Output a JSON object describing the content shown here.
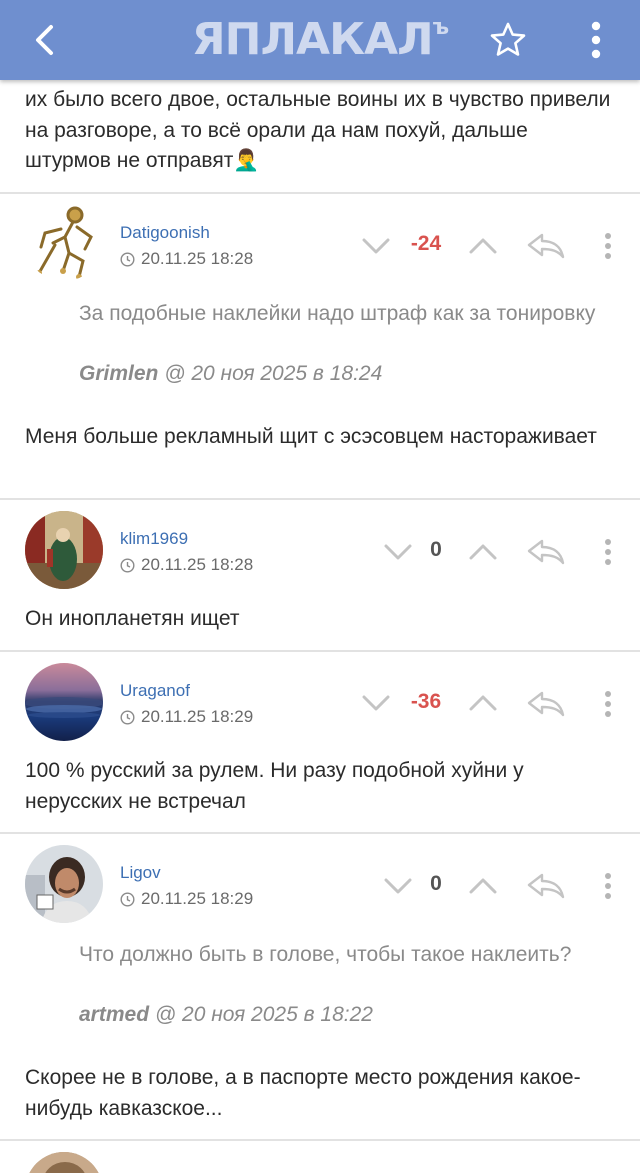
{
  "header": {
    "logo_text": "ЯПЛАКАЛ",
    "logo_sign": "ъ",
    "back_icon": "chevron-left-icon",
    "star_icon": "star-outline-icon",
    "more_icon": "vertical-dots-icon"
  },
  "colors": {
    "header_bg": "#6f8fcf",
    "username": "#3d6fb3",
    "negative_rating": "#d9534f",
    "neutral_rating": "#555555",
    "quote_text": "#8a8a8a",
    "icon_gray": "#c4c4c4"
  },
  "top_fragment": {
    "text": "их было всего двое, остальные воины их в чувство привели на разговоре, а то всё орали да нам похуй, дальше штурмов не отправят",
    "emoji": "🤦‍♂️"
  },
  "comments": [
    {
      "username": "Datigoonish",
      "date": "20.11.25 18:28",
      "rating": "-24",
      "quote": {
        "text": "За подобные наклейки надо штраф как за тонировку",
        "author": "Grimlen",
        "date": "@ 20 ноя 2025 в 18:24"
      },
      "text": "Меня больше рекламный щит с эсэсовцем настораживает"
    },
    {
      "username": "klim1969",
      "date": "20.11.25 18:28",
      "rating": "0",
      "text": "Он инопланетян ищет"
    },
    {
      "username": "Uraganof",
      "date": "20.11.25 18:29",
      "rating": "-36",
      "text": "100 % русский за рулем. Ни разу подобной хуйни у нерусских не встречал"
    },
    {
      "username": "Ligov",
      "date": "20.11.25 18:29",
      "rating": "0",
      "quote": {
        "text": "Что должно быть в голове, чтобы такое наклеить?",
        "author": "artmed",
        "date": "@ 20 ноя 2025 в 18:22"
      },
      "text": "Скорее не в голове, а в паспорте место рождения какое-нибудь кавказское..."
    }
  ]
}
